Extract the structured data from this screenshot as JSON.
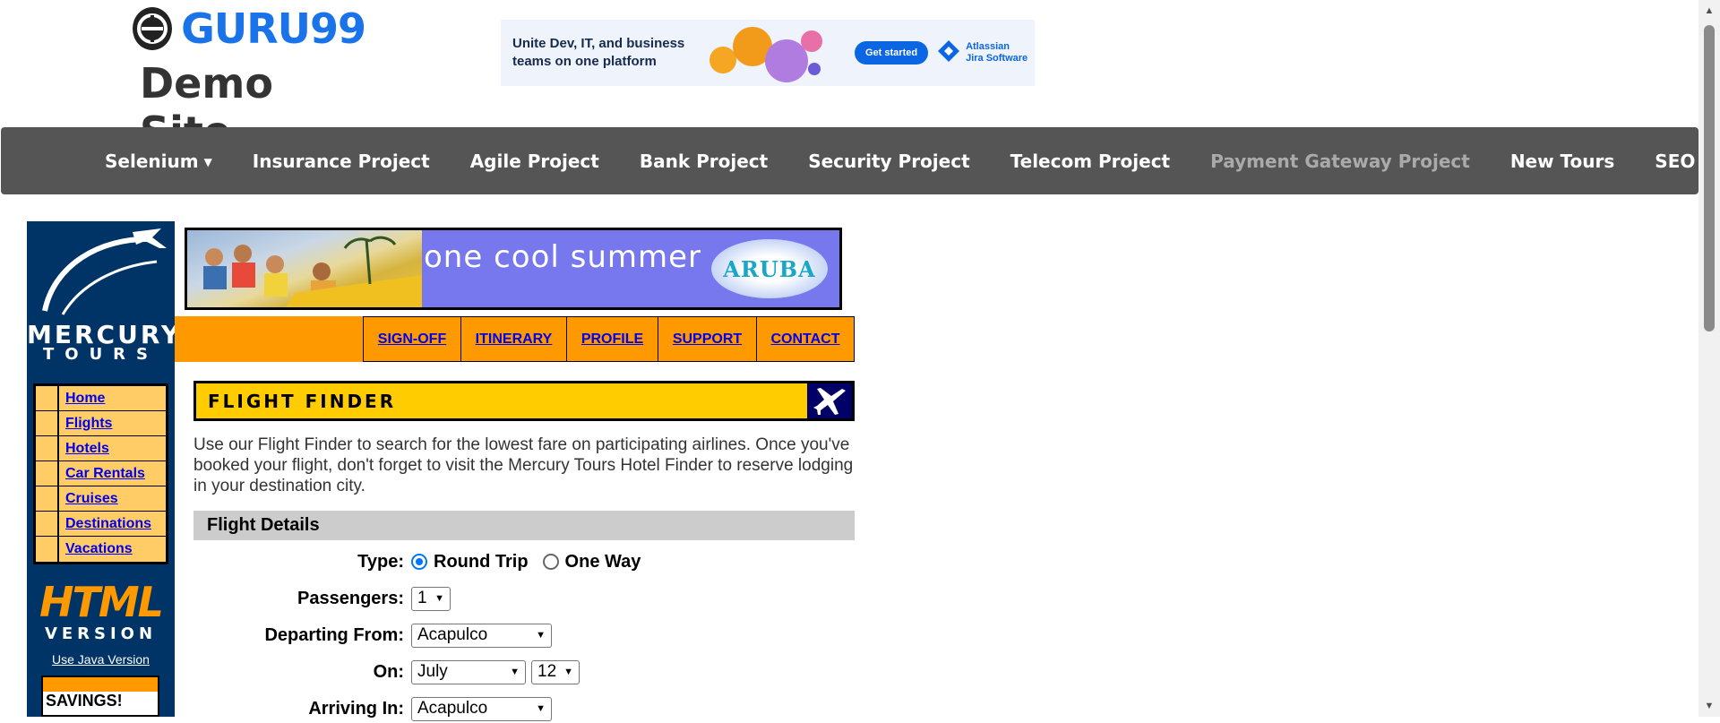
{
  "site": {
    "logo_text": "GURU99",
    "subtitle": "Demo Site"
  },
  "ad": {
    "headline": "Unite Dev, IT, and business teams on one platform",
    "cta": "Get started",
    "brand_line1": "Atlassian",
    "brand_line2": "Jira Software"
  },
  "nav": {
    "items": [
      {
        "label": "Selenium",
        "dropdown": true
      },
      {
        "label": "Insurance Project"
      },
      {
        "label": "Agile Project"
      },
      {
        "label": "Bank Project"
      },
      {
        "label": "Security Project"
      },
      {
        "label": "Telecom Project"
      },
      {
        "label": "Payment Gateway Project"
      },
      {
        "label": "New Tours"
      },
      {
        "label": "SEO",
        "dropdown": true
      }
    ]
  },
  "mercury": {
    "logo_line1": "MERCURY",
    "logo_line2": "TOURS",
    "menu": [
      "Home",
      "Flights",
      "Hotels",
      "Car Rentals",
      "Cruises",
      "Destinations",
      "Vacations"
    ],
    "html_word": "HTML",
    "version_word": "VERSION",
    "java_link": "Use Java Version",
    "savings_title": "SAVINGS!",
    "banner_text": "one cool summer",
    "banner_brand": "ARUBA",
    "top_links": [
      "SIGN-OFF",
      "ITINERARY",
      "PROFILE",
      "SUPPORT",
      "CONTACT"
    ]
  },
  "flight_finder": {
    "title": "FLIGHT FINDER",
    "description": "Use our Flight Finder to search for the lowest fare on participating airlines. Once you've booked your flight, don't forget to visit the Mercury Tours Hotel Finder to reserve lodging in your destination city.",
    "section_title": "Flight Details",
    "type_label": "Type:",
    "round_trip": "Round Trip",
    "one_way": "One Way",
    "passengers_label": "Passengers:",
    "passengers_value": "1",
    "departing_label": "Departing From:",
    "departing_value": "Acapulco",
    "on_label": "On:",
    "on_month": "July",
    "on_day": "12",
    "arriving_label": "Arriving In:",
    "arriving_value": "Acapulco"
  },
  "colors": {
    "nav_bg": "#555555",
    "mercury_navy": "#003366",
    "mercury_orange": "#ff9900",
    "mercury_yellow": "#ffcc00",
    "link_blue": "#0000ee"
  }
}
